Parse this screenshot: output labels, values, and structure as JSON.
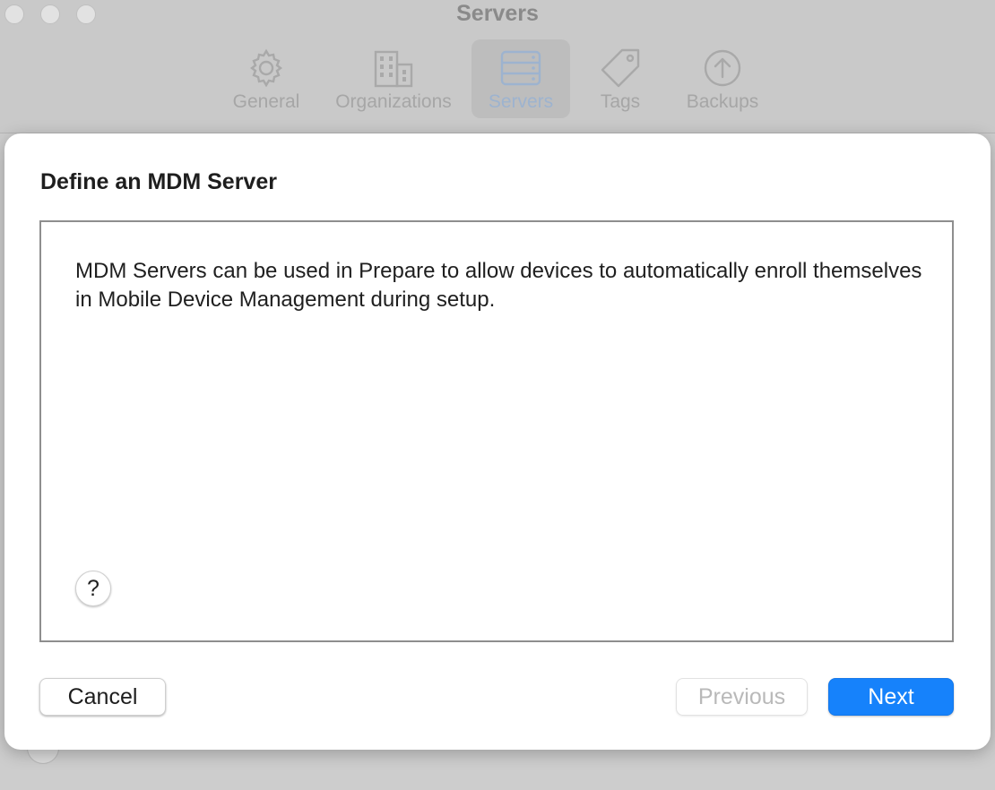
{
  "window": {
    "title": "Servers"
  },
  "toolbar": {
    "items": [
      {
        "label": "General",
        "icon": "gear-icon"
      },
      {
        "label": "Organizations",
        "icon": "building-icon"
      },
      {
        "label": "Servers",
        "icon": "server-icon",
        "active": true
      },
      {
        "label": "Tags",
        "icon": "tag-icon"
      },
      {
        "label": "Backups",
        "icon": "upload-circle-icon"
      }
    ]
  },
  "sheet": {
    "title": "Define an MDM Server",
    "description": "MDM Servers can be used in Prepare to allow devices to automatically enroll themselves in Mobile Device Management during setup.",
    "help_label": "?",
    "buttons": {
      "cancel": "Cancel",
      "previous": "Previous",
      "next": "Next"
    }
  },
  "colors": {
    "accent": "#1682fb",
    "disabled_text": "#b9b9b9"
  }
}
